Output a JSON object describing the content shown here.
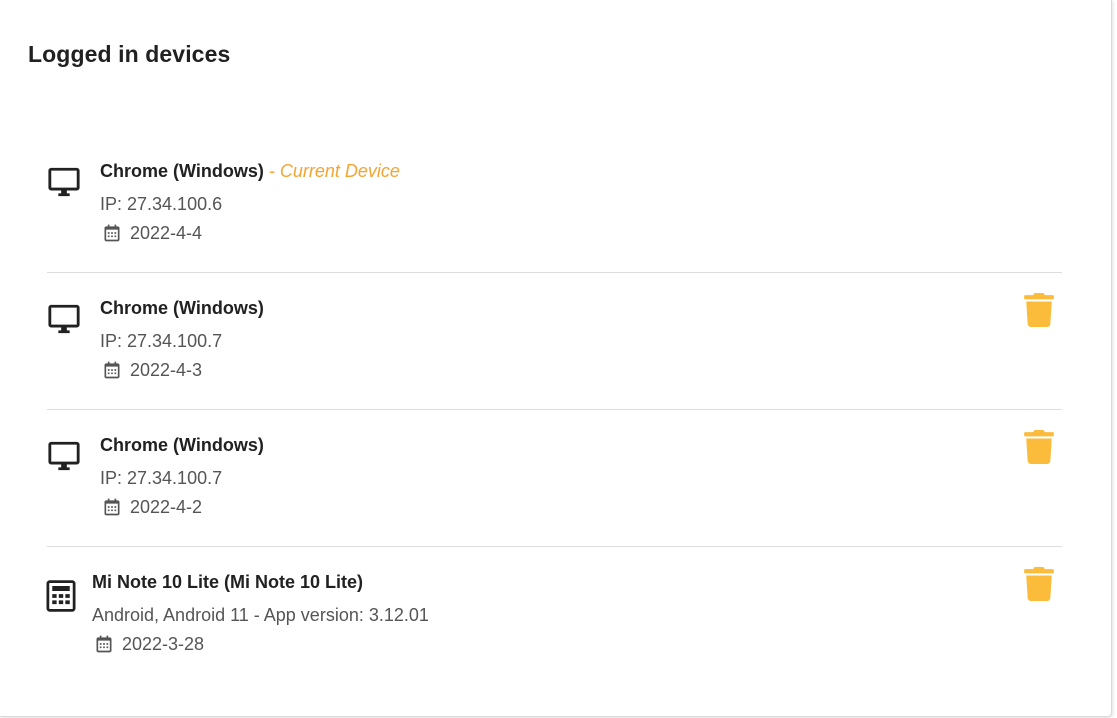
{
  "page": {
    "title": "Logged in devices"
  },
  "colors": {
    "accent": "#f5a431",
    "trash": "#fbbc3c",
    "text": "#212121",
    "muted": "#555555",
    "divider": "#dddddd"
  },
  "devices": [
    {
      "icon": "desktop-icon",
      "name": "Chrome (Windows)",
      "current_label": " - Current Device",
      "detail": "IP: 27.34.100.6",
      "date": "2022-4-4",
      "deletable": false
    },
    {
      "icon": "desktop-icon",
      "name": "Chrome (Windows)",
      "current_label": "",
      "detail": "IP: 27.34.100.7",
      "date": "2022-4-3",
      "deletable": true
    },
    {
      "icon": "desktop-icon",
      "name": "Chrome (Windows)",
      "current_label": "",
      "detail": "IP: 27.34.100.7",
      "date": "2022-4-2",
      "deletable": true
    },
    {
      "icon": "phone-icon",
      "name": "Mi Note 10 Lite (Mi Note 10 Lite)",
      "current_label": "",
      "detail": "Android, Android 11 - App version: 3.12.01",
      "date": "2022-3-28",
      "deletable": true
    }
  ]
}
